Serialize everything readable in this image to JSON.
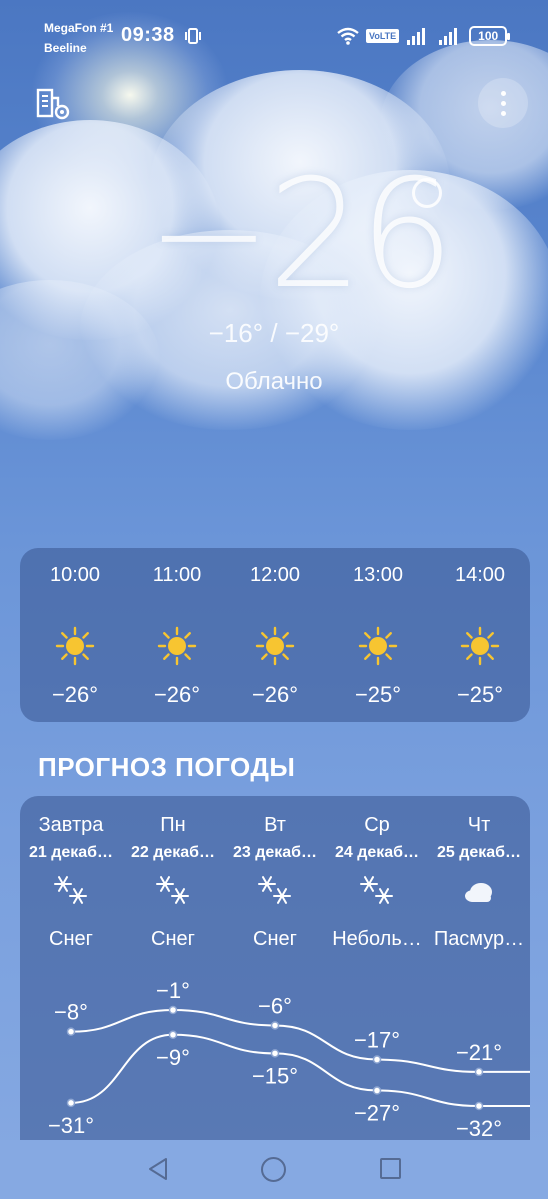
{
  "status_bar": {
    "carrier1": "MegaFon #1",
    "carrier2": "Beeline",
    "time": "09:38",
    "volte": "VoLTE",
    "battery": "100"
  },
  "current": {
    "temperature": "−26",
    "range": "−16° / −29°",
    "condition": "Облачно"
  },
  "hourly": [
    {
      "time": "10:00",
      "temp": "−26°",
      "icon": "sun-icon"
    },
    {
      "time": "11:00",
      "temp": "−26°",
      "icon": "sun-icon"
    },
    {
      "time": "12:00",
      "temp": "−26°",
      "icon": "sun-icon"
    },
    {
      "time": "13:00",
      "temp": "−25°",
      "icon": "sun-icon"
    },
    {
      "time": "14:00",
      "temp": "−25°",
      "icon": "sun-icon"
    }
  ],
  "forecast_title": "ПРОГНОЗ ПОГОДЫ",
  "daily": [
    {
      "name": "Завтра",
      "date": "21 декаб…",
      "icon": "snow-icon",
      "condition": "Снег",
      "high": -8,
      "low": -31,
      "high_label": "−8°",
      "low_label": "−31°"
    },
    {
      "name": "Пн",
      "date": "22 декаб…",
      "icon": "snow-icon",
      "condition": "Снег",
      "high": -1,
      "low": -9,
      "high_label": "−1°",
      "low_label": "−9°"
    },
    {
      "name": "Вт",
      "date": "23 декаб…",
      "icon": "snow-icon",
      "condition": "Снег",
      "high": -6,
      "low": -15,
      "high_label": "−6°",
      "low_label": "−15°"
    },
    {
      "name": "Ср",
      "date": "24 декаб…",
      "icon": "snow-icon",
      "condition": "Неболь…",
      "high": -17,
      "low": -27,
      "high_label": "−17°",
      "low_label": "−27°"
    },
    {
      "name": "Чт",
      "date": "25 декаб…",
      "icon": "cloud-icon",
      "condition": "Пасмур…",
      "high": -21,
      "low": -32,
      "high_label": "−21°",
      "low_label": "−32°"
    }
  ],
  "colors": {
    "sun": "#f7c531",
    "card": "#3c5a96"
  }
}
